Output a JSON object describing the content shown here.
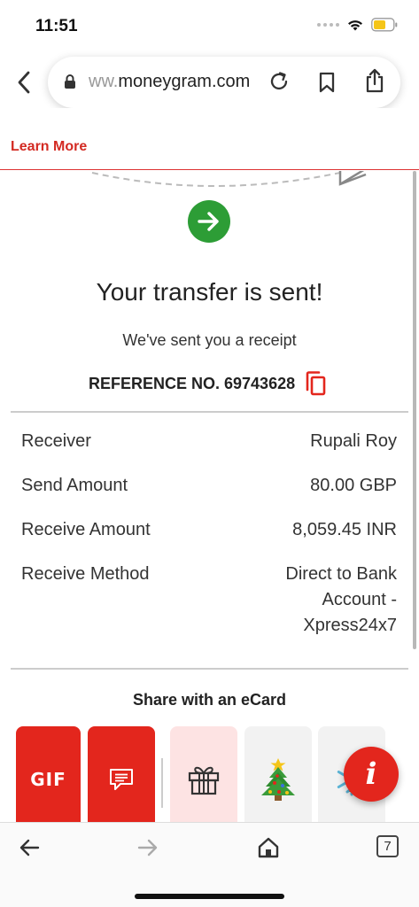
{
  "status_bar": {
    "time": "11:51"
  },
  "browser": {
    "url_faded_prefix": "ww.",
    "url_main": "moneygram.com",
    "tab_count": "7"
  },
  "banner": {
    "learn_more": "Learn More"
  },
  "confirmation": {
    "title": "Your transfer is sent!",
    "subtitle": "We've sent you a receipt",
    "reference_label": "REFERENCE NO. 69743628"
  },
  "details": [
    {
      "label": "Receiver",
      "value": "Rupali Roy"
    },
    {
      "label": "Send Amount",
      "value": "80.00 GBP"
    },
    {
      "label": "Receive Amount",
      "value": "8,059.45 INR"
    },
    {
      "label": "Receive Method",
      "value": "Direct to Bank Account - Xpress24x7"
    }
  ],
  "share": {
    "title": "Share with an eCard",
    "gif_label": "GIF"
  },
  "fab": {
    "label": "i"
  },
  "colors": {
    "brand_red": "#e3261d",
    "success_green": "#2d9d36"
  },
  "icons": [
    "back-chevron-icon",
    "lock-icon",
    "reload-icon",
    "bookmark-icon",
    "share-icon",
    "arrow-right-icon",
    "copy-icon",
    "message-icon",
    "gift-icon",
    "christmas-tree-icon",
    "snowflake-icon",
    "info-icon",
    "nav-back-icon",
    "nav-forward-icon",
    "home-icon",
    "tabs-icon"
  ]
}
